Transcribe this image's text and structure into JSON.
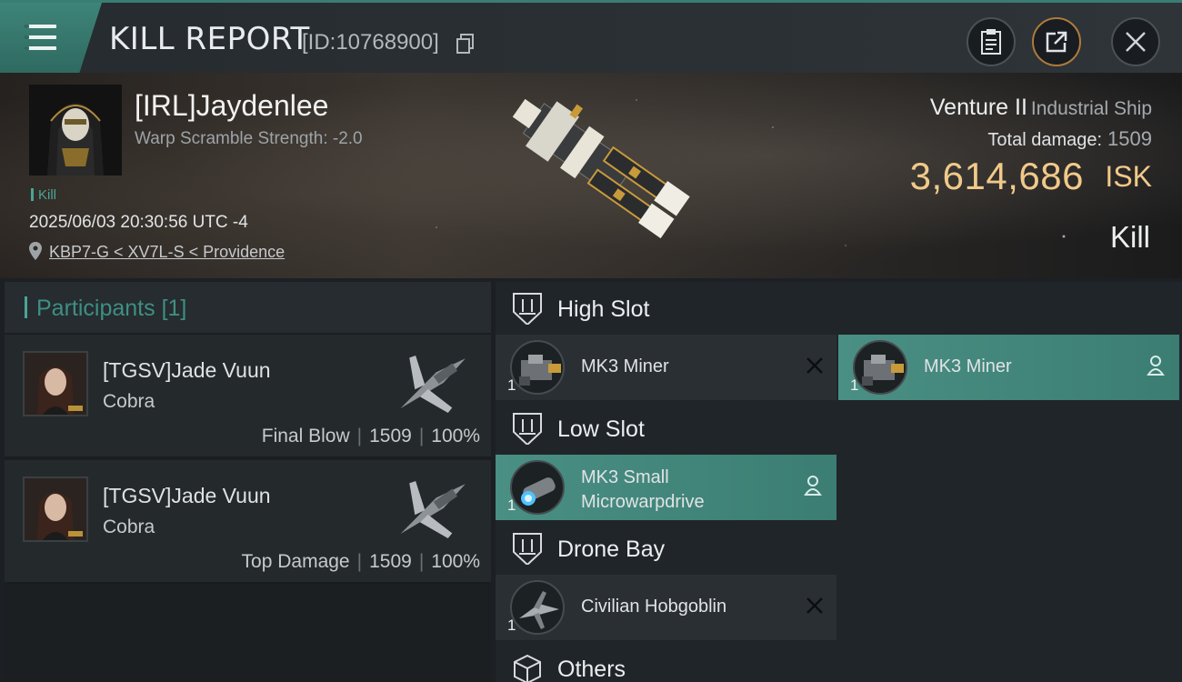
{
  "header": {
    "title": "KILL REPORT",
    "report_id": "[ID:10768900]"
  },
  "victim": {
    "pilot": "[IRL]Jaydenlee",
    "warp_scramble": "Warp Scramble Strength: -2.0",
    "tag": "Kill",
    "datetime": "2025/06/03 20:30:56 UTC -4",
    "location": "KBP7-G < XV7L-S < Providence",
    "ship": "Venture II",
    "ship_class": "Industrial Ship",
    "total_damage_label": "Total damage:",
    "total_damage": "1509",
    "isk_value": "3,614,686",
    "isk_unit": "ISK",
    "result": "Kill"
  },
  "participants": {
    "title": "Participants",
    "count": "[1]",
    "rows": [
      {
        "name": "[TGSV]Jade Vuun",
        "ship": "Cobra",
        "label": "Final Blow",
        "damage": "1509",
        "percent": "100%"
      },
      {
        "name": "[TGSV]Jade Vuun",
        "ship": "Cobra",
        "label": "Top Damage",
        "damage": "1509",
        "percent": "100%"
      }
    ]
  },
  "fitting": {
    "high_slot": "High Slot",
    "low_slot": "Low Slot",
    "drone_bay": "Drone Bay",
    "others": "Others",
    "high_modules": [
      {
        "name": "MK3 Miner",
        "qty": "1",
        "state": "destroyed"
      },
      {
        "name": "MK3 Miner",
        "qty": "1",
        "state": "dropped"
      }
    ],
    "low_modules": [
      {
        "name_line1": "MK3 Small",
        "name_line2": "Microwarpdrive",
        "qty": "1",
        "state": "dropped"
      }
    ],
    "drones": [
      {
        "name": "Civilian Hobgoblin",
        "qty": "1",
        "state": "destroyed"
      }
    ]
  },
  "colors": {
    "accent": "#4aa597",
    "isk": "#f0c98a",
    "fitted_bg": "#3b7d72"
  }
}
